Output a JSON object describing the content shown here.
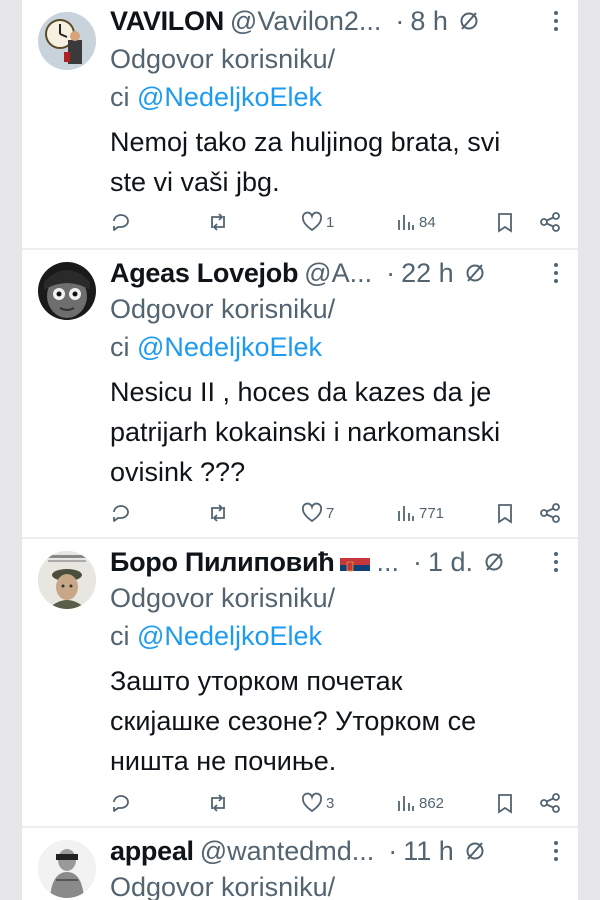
{
  "reply_prefix": "Odgovor korisniku/",
  "reply_prefix_ci": "ci",
  "tweets": [
    {
      "name": "VAVILON",
      "handle": "@Vavilon2...",
      "separator": "·",
      "time": "8 h",
      "mention": "@NedeljkoElek",
      "text_lines": [
        "Nemoj tako za huljinog brata, svi",
        "ste vi vaši jbg."
      ],
      "replies": "",
      "reposts": "",
      "likes": "1",
      "views": "84"
    },
    {
      "name": "Ageas Lovejob",
      "handle": "@A...",
      "separator": "·",
      "time": "22 h",
      "mention": "@NedeljkoElek",
      "text_lines": [
        "Nesicu II , hoces da kazes da je",
        "patrijarh kokainski i narkomanski",
        "ovisink  ???"
      ],
      "replies": "",
      "reposts": "",
      "likes": "7",
      "views": "771"
    },
    {
      "name": "Боро Пилиповић",
      "handle": "...",
      "separator": "·",
      "time": "1 d.",
      "mention": "@NedeljkoElek",
      "text_lines": [
        "Зашто уторком почетак",
        "скијашке сезоне? Уторком се",
        "ништа не почиње."
      ],
      "replies": "",
      "reposts": "",
      "likes": "3",
      "views": "862"
    },
    {
      "name": "appeal",
      "handle": "@wantedmd...",
      "separator": "·",
      "time": "11 h",
      "mention": "",
      "text_lines": [],
      "replies": "",
      "reposts": "",
      "likes": "",
      "views": ""
    }
  ],
  "icons": {
    "reply": "reply-icon",
    "repost": "repost-icon",
    "like": "like-icon",
    "views": "views-icon",
    "bookmark": "bookmark-icon",
    "share": "share-icon",
    "more": "more-icon",
    "grok": "grok-icon"
  },
  "colors": {
    "text": "#0f1419",
    "secondary": "#536471",
    "link": "#1d9bf0",
    "background": "#ffffff"
  }
}
